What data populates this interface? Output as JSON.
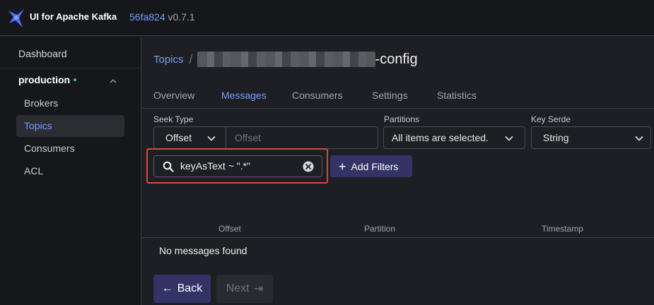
{
  "header": {
    "app_name": "UI for Apache Kafka",
    "version_hash": "56fa824",
    "version": "v0.7.1",
    "brand_color": "#4a6cf7"
  },
  "sidebar": {
    "dashboard": "Dashboard",
    "cluster": {
      "name": "production",
      "status_color": "#2ed573"
    },
    "items": [
      {
        "label": "Brokers",
        "active": false
      },
      {
        "label": "Topics",
        "active": true
      },
      {
        "label": "Consumers",
        "active": false
      },
      {
        "label": "ACL",
        "active": false
      }
    ]
  },
  "breadcrumb": {
    "root": "Topics",
    "separator": "/",
    "topic_suffix": "-config"
  },
  "tabs": [
    {
      "label": "Overview",
      "active": false
    },
    {
      "label": "Messages",
      "active": true
    },
    {
      "label": "Consumers",
      "active": false
    },
    {
      "label": "Settings",
      "active": false
    },
    {
      "label": "Statistics",
      "active": false
    }
  ],
  "controls": {
    "seek_type": {
      "label": "Seek Type",
      "value": "Offset",
      "input_placeholder": "Offset"
    },
    "partitions": {
      "label": "Partitions",
      "value": "All items are selected."
    },
    "key_serde": {
      "label": "Key Serde",
      "value": "String"
    }
  },
  "filter": {
    "chip_text": "keyAsText ~ \".*\"",
    "add_label": "Add Filters",
    "highlight_color": "#d9483b"
  },
  "table": {
    "columns": [
      "Offset",
      "Partition",
      "Timestamp"
    ],
    "empty_text": "No messages found"
  },
  "pagination": {
    "back_label": "Back",
    "next_label": "Next"
  }
}
